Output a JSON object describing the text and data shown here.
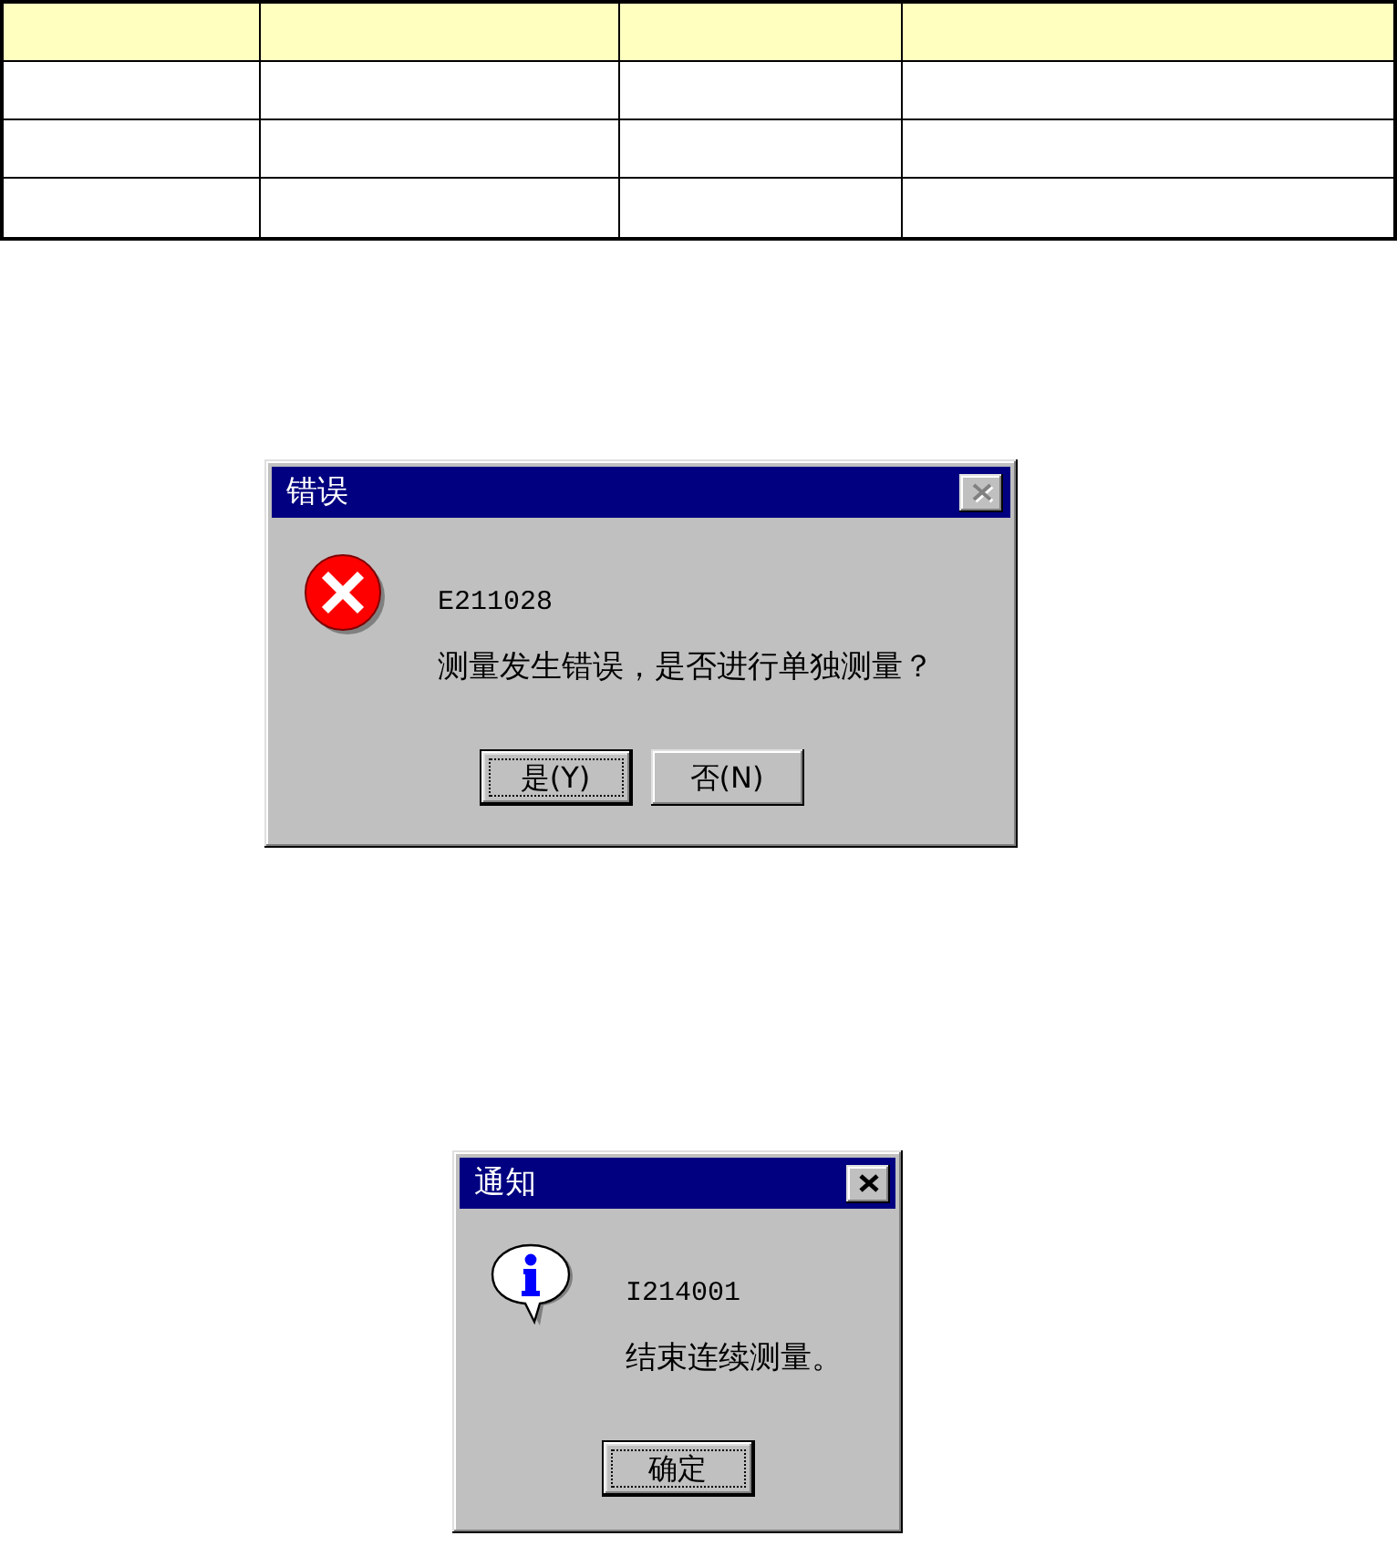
{
  "table": {
    "columns": [
      {
        "kind": "blank"
      },
      {
        "kind": "blank"
      },
      {
        "kind": "blank"
      },
      {
        "kind": "blank"
      }
    ],
    "rows": [
      {
        "kind": "header"
      },
      {
        "kind": "body"
      },
      {
        "kind": "body"
      },
      {
        "kind": "body"
      }
    ]
  },
  "dialogs": [
    {
      "kind": "error",
      "title": "错误",
      "close_button": {
        "disabled": true
      },
      "code": "E211028",
      "message": "测量发生错误，是否进行单独测量？",
      "buttons": [
        {
          "label": "是(Y)",
          "default": true
        },
        {
          "label": "否(N)",
          "default": false
        }
      ]
    },
    {
      "kind": "info",
      "title": "通知",
      "close_button": {
        "disabled": false
      },
      "code": "I214001",
      "message": "结束连续测量。",
      "buttons": [
        {
          "label": "确定",
          "default": true
        }
      ]
    }
  ]
}
